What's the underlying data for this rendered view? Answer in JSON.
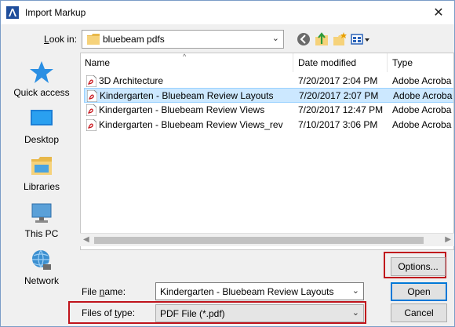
{
  "window": {
    "title": "Import Markup",
    "close_glyph": "✕"
  },
  "toolbar": {
    "look_in_label": "Look in:",
    "look_in_value": "bluebeam pdfs",
    "icons": [
      "back-arrow-icon",
      "up-folder-icon",
      "new-folder-icon",
      "view-menu-icon"
    ]
  },
  "places": [
    {
      "label": "Quick access",
      "icon": "star-icon"
    },
    {
      "label": "Desktop",
      "icon": "desktop-icon"
    },
    {
      "label": "Libraries",
      "icon": "libraries-icon"
    },
    {
      "label": "This PC",
      "icon": "computer-icon"
    },
    {
      "label": "Network",
      "icon": "network-icon"
    }
  ],
  "file_list": {
    "columns": [
      "Name",
      "Date modified",
      "Type"
    ],
    "rows": [
      {
        "name": "3D Architecture",
        "date": "7/20/2017 2:04 PM",
        "type": "Adobe Acroba",
        "selected": false
      },
      {
        "name": "Kindergarten - Bluebeam Review Layouts",
        "date": "7/20/2017 2:07 PM",
        "type": "Adobe Acroba",
        "selected": true
      },
      {
        "name": "Kindergarten - Bluebeam Review Views",
        "date": "7/20/2017 12:47 PM",
        "type": "Adobe Acroba",
        "selected": false
      },
      {
        "name": "Kindergarten - Bluebeam Review Views_rev",
        "date": "7/10/2017 3:06 PM",
        "type": "Adobe Acroba",
        "selected": false
      }
    ]
  },
  "bottom": {
    "file_name_label": "File name:",
    "file_name_value": "Kindergarten - Bluebeam Review Layouts",
    "files_of_type_label": "Files of type:",
    "files_of_type_value": "PDF File (*.pdf)",
    "options_label": "Options...",
    "open_label": "Open",
    "cancel_label": "Cancel"
  },
  "colors": {
    "highlight_box": "#c0141c",
    "selection": "#cce8ff",
    "accent": "#0078d7"
  }
}
